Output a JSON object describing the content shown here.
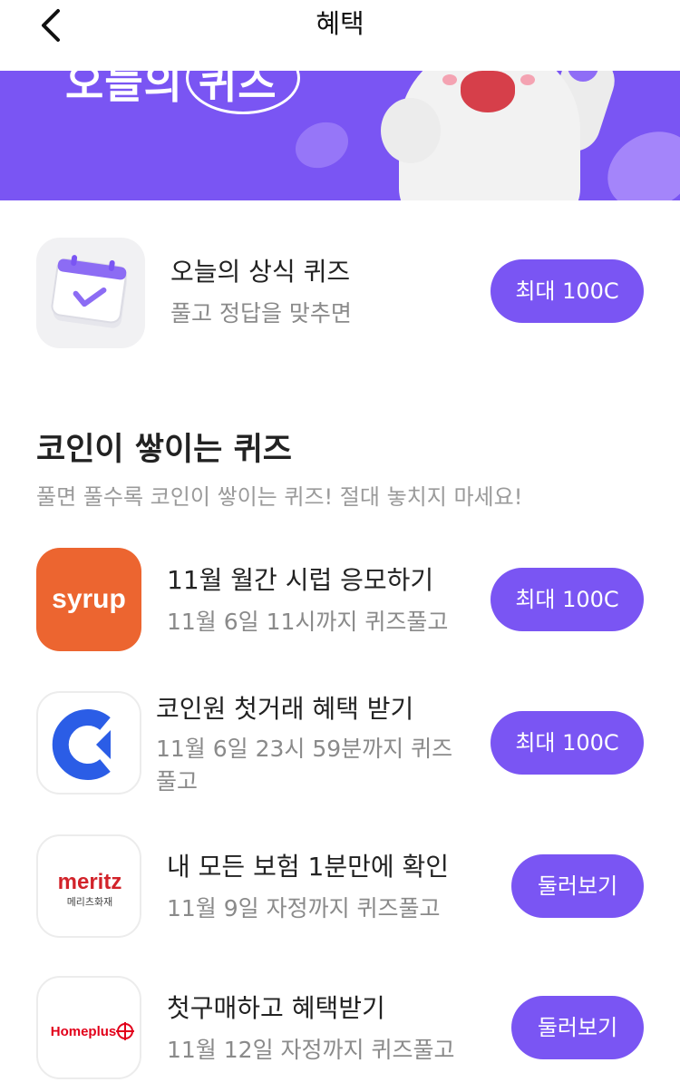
{
  "header": {
    "title": "혜택",
    "back_icon": "chevron-left-icon"
  },
  "banner": {
    "title_text": "오늘의 퀴즈",
    "bg_color": "#7a55f3"
  },
  "daily_quiz": {
    "title": "오늘의 상식 퀴즈",
    "subtitle": "풀고 정답을 맞추면",
    "button": "최대 100C",
    "icon": "calendar-check-icon"
  },
  "section": {
    "title": "코인이 쌓이는 퀴즈",
    "subtitle": "풀면 풀수록 코인이 쌓이는 퀴즈! 절대 놓치지 마세요!"
  },
  "quizzes": [
    {
      "title": "11월 월간 시럽 응모하기",
      "subtitle": "11월 6일 11시까지 퀴즈풀고",
      "button": "최대 100C",
      "logo": "syrup"
    },
    {
      "title": "코인원 첫거래 혜택 받기",
      "subtitle_line1": "11월 6일 23시 59분까지 퀴즈",
      "subtitle_line2": "풀고",
      "button": "최대 100C",
      "logo": "coinone"
    },
    {
      "title": "내 모든 보험 1분만에 확인",
      "subtitle": "11월 9일 자정까지 퀴즈풀고",
      "button": "둘러보기",
      "logo": "meritz",
      "logo_sub": "메리츠화재"
    },
    {
      "title": "첫구매하고 혜택받기",
      "subtitle": "11월 12일 자정까지 퀴즈풀고",
      "button": "둘러보기",
      "logo": "Homeplus"
    }
  ],
  "colors": {
    "accent": "#7a55f3",
    "syrup": "#ec6530",
    "coinone": "#2b5de6",
    "meritz": "#d2232a",
    "homeplus": "#e2001a"
  }
}
